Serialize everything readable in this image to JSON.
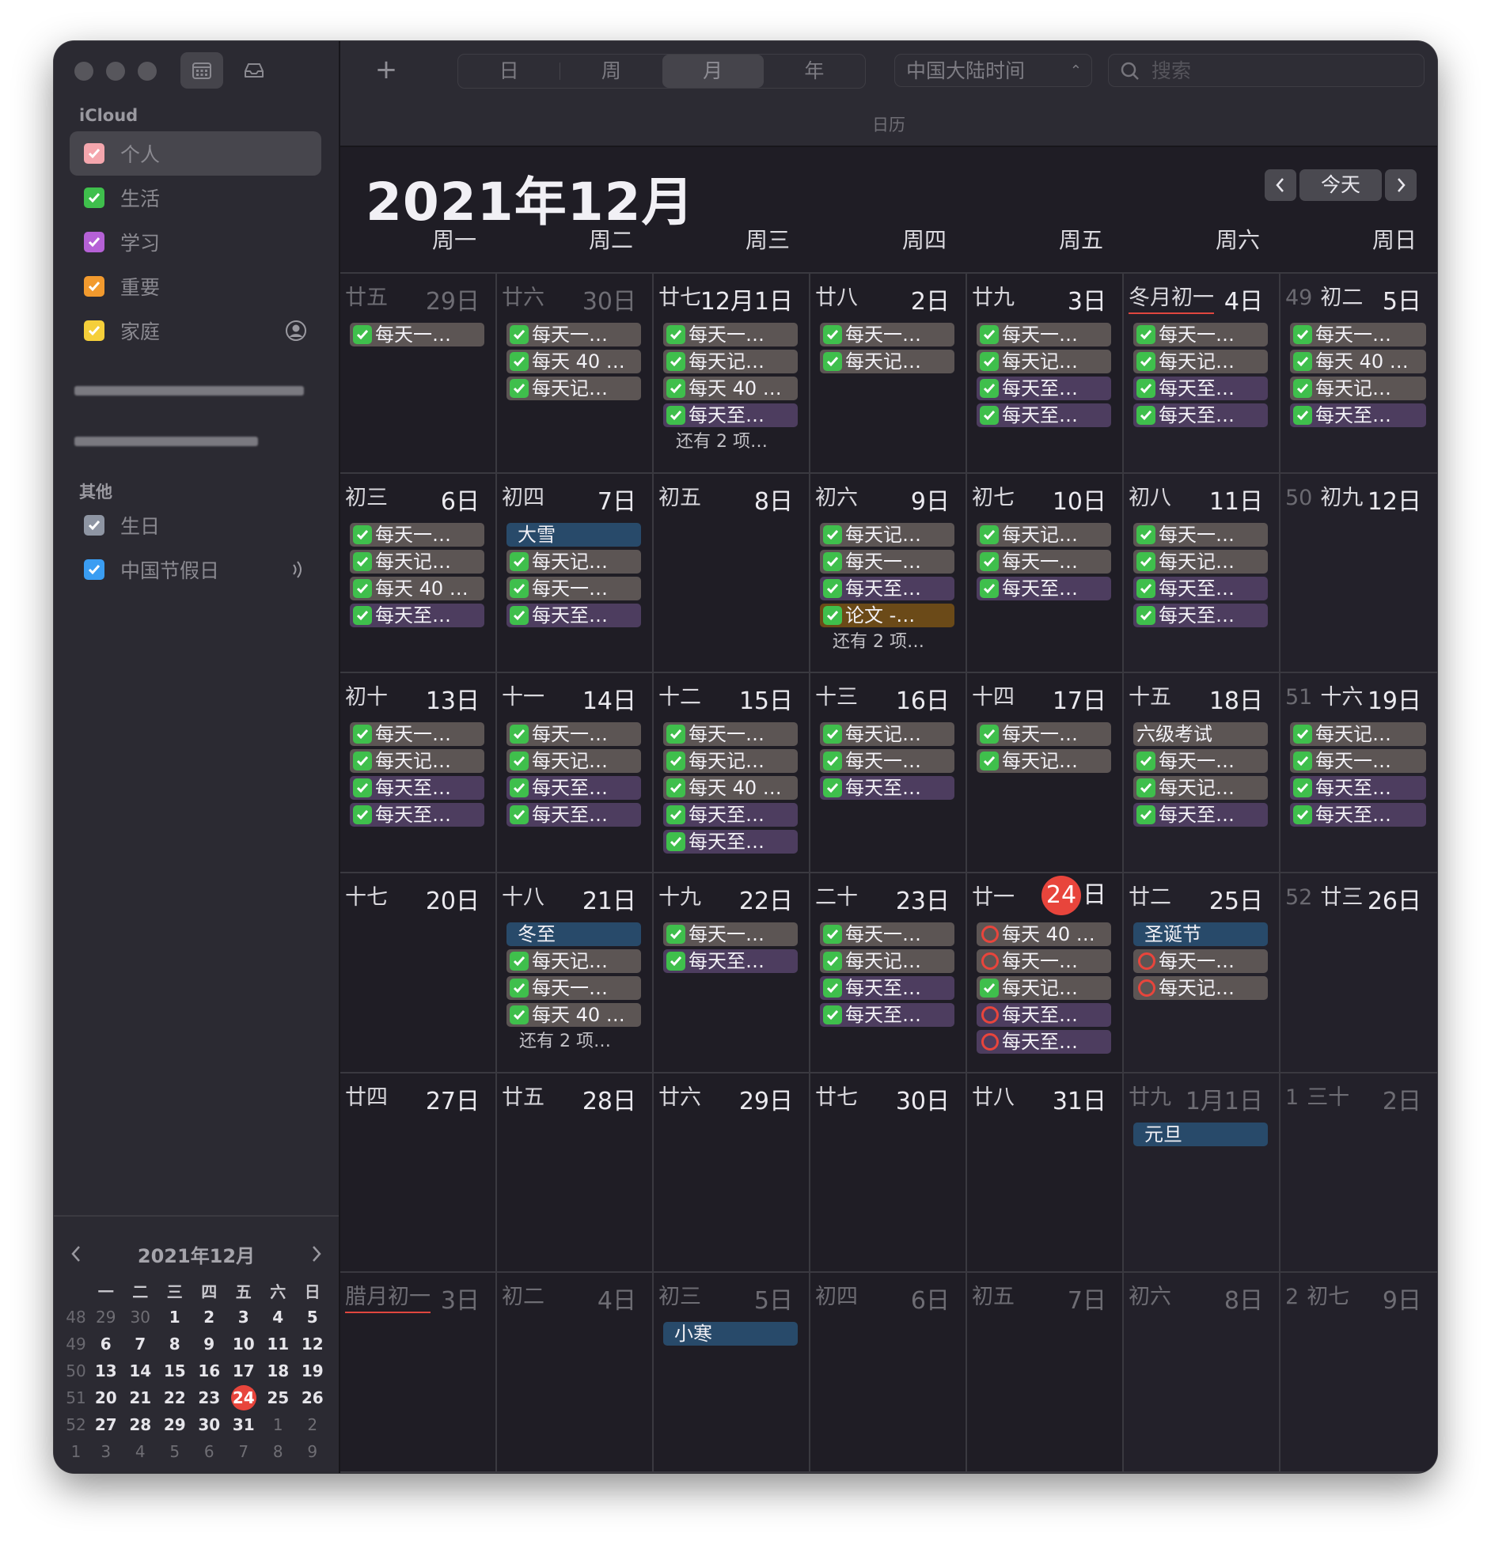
{
  "sidebar": {
    "icloud_title": "iCloud",
    "calendars": [
      {
        "label": "个人",
        "color": "#f4a6ad",
        "selected": true
      },
      {
        "label": "生活",
        "color": "#3fbf4c"
      },
      {
        "label": "学习",
        "color": "#b561d6"
      },
      {
        "label": "重要",
        "color": "#f29a2e"
      },
      {
        "label": "家庭",
        "color": "#f5cf3a"
      }
    ],
    "other_title": "其他",
    "others": [
      {
        "label": "生日",
        "color": "#8e95a3"
      },
      {
        "label": "中国节假日",
        "color": "#3a9df2"
      }
    ],
    "mini": {
      "title": "2021年12月",
      "headers": [
        "一",
        "二",
        "三",
        "四",
        "五",
        "六",
        "日"
      ],
      "rows": [
        {
          "wk": "48",
          "days": [
            "29",
            "30",
            "1",
            "2",
            "3",
            "4",
            "5"
          ]
        },
        {
          "wk": "49",
          "days": [
            "6",
            "7",
            "8",
            "9",
            "10",
            "11",
            "12"
          ]
        },
        {
          "wk": "50",
          "days": [
            "13",
            "14",
            "15",
            "16",
            "17",
            "18",
            "19"
          ]
        },
        {
          "wk": "51",
          "days": [
            "20",
            "21",
            "22",
            "23",
            "24",
            "25",
            "26"
          ]
        },
        {
          "wk": "52",
          "days": [
            "27",
            "28",
            "29",
            "30",
            "31",
            "1",
            "2"
          ]
        },
        {
          "wk": "1",
          "days": [
            "3",
            "4",
            "5",
            "6",
            "7",
            "8",
            "9"
          ]
        }
      ]
    }
  },
  "toolbar": {
    "add": "+",
    "views": [
      "日",
      "周",
      "月",
      "年"
    ],
    "active_view": "月",
    "timezone": "中国大陆时间",
    "search_placeholder": "搜索",
    "subtitle": "日历"
  },
  "header": {
    "title": "2021年12月",
    "today": "今天",
    "weekdays": [
      "周一",
      "周二",
      "周三",
      "周四",
      "周五",
      "周六",
      "周日"
    ]
  },
  "weeks": [
    [
      {
        "lunar": "廿五",
        "day": "29日",
        "dim": true,
        "events": [
          {
            "t": "每天一…",
            "c": "gray",
            "i": "check"
          }
        ]
      },
      {
        "lunar": "廿六",
        "day": "30日",
        "dim": true,
        "events": [
          {
            "t": "每天一…",
            "c": "gray",
            "i": "check"
          },
          {
            "t": "每天 40 …",
            "c": "gray",
            "i": "check"
          },
          {
            "t": "每天记…",
            "c": "gray",
            "i": "check"
          }
        ]
      },
      {
        "lunar": "廿七",
        "day": "12月1日",
        "events": [
          {
            "t": "每天一…",
            "c": "gray",
            "i": "check"
          },
          {
            "t": "每天记…",
            "c": "gray",
            "i": "check"
          },
          {
            "t": "每天 40 …",
            "c": "gray",
            "i": "check"
          },
          {
            "t": "每天至…",
            "c": "purple",
            "i": "check"
          }
        ],
        "more": "还有 2 项…"
      },
      {
        "lunar": "廿八",
        "day": "2日",
        "events": [
          {
            "t": "每天一…",
            "c": "gray",
            "i": "check"
          },
          {
            "t": "每天记…",
            "c": "gray",
            "i": "check"
          }
        ]
      },
      {
        "lunar": "廿九",
        "day": "3日",
        "events": [
          {
            "t": "每天一…",
            "c": "gray",
            "i": "check"
          },
          {
            "t": "每天记…",
            "c": "gray",
            "i": "check"
          },
          {
            "t": "每天至…",
            "c": "purple",
            "i": "check"
          },
          {
            "t": "每天至…",
            "c": "purple",
            "i": "check"
          }
        ]
      },
      {
        "lunar": "冬月初一",
        "day": "4日",
        "term": true,
        "events": [
          {
            "t": "每天一…",
            "c": "gray",
            "i": "check"
          },
          {
            "t": "每天记…",
            "c": "gray",
            "i": "check"
          },
          {
            "t": "每天至…",
            "c": "purple",
            "i": "check"
          },
          {
            "t": "每天至…",
            "c": "purple",
            "i": "check"
          }
        ]
      },
      {
        "wk": "49",
        "lunar": "初二",
        "day": "5日",
        "events": [
          {
            "t": "每天一…",
            "c": "gray",
            "i": "check"
          },
          {
            "t": "每天 40 …",
            "c": "gray",
            "i": "check"
          },
          {
            "t": "每天记…",
            "c": "gray",
            "i": "check"
          },
          {
            "t": "每天至…",
            "c": "purple",
            "i": "check"
          }
        ]
      }
    ],
    [
      {
        "lunar": "初三",
        "day": "6日",
        "events": [
          {
            "t": "每天一…",
            "c": "gray",
            "i": "check"
          },
          {
            "t": "每天记…",
            "c": "gray",
            "i": "check"
          },
          {
            "t": "每天 40 …",
            "c": "gray",
            "i": "check"
          },
          {
            "t": "每天至…",
            "c": "purple",
            "i": "check"
          }
        ]
      },
      {
        "lunar": "初四",
        "day": "7日",
        "events": [
          {
            "t": "大雪",
            "c": "blue"
          },
          {
            "t": "每天记…",
            "c": "gray",
            "i": "check"
          },
          {
            "t": "每天一…",
            "c": "gray",
            "i": "check"
          },
          {
            "t": "每天至…",
            "c": "purple",
            "i": "check"
          }
        ]
      },
      {
        "lunar": "初五",
        "day": "8日",
        "events": []
      },
      {
        "lunar": "初六",
        "day": "9日",
        "events": [
          {
            "t": "每天记…",
            "c": "gray",
            "i": "check"
          },
          {
            "t": "每天一…",
            "c": "gray",
            "i": "check"
          },
          {
            "t": "每天至…",
            "c": "purple",
            "i": "check"
          },
          {
            "t": "论文 -…",
            "c": "brown",
            "i": "check"
          }
        ],
        "more": "还有 2 项…"
      },
      {
        "lunar": "初七",
        "day": "10日",
        "events": [
          {
            "t": "每天记…",
            "c": "gray",
            "i": "check"
          },
          {
            "t": "每天一…",
            "c": "gray",
            "i": "check"
          },
          {
            "t": "每天至…",
            "c": "purple",
            "i": "check"
          }
        ]
      },
      {
        "lunar": "初八",
        "day": "11日",
        "events": [
          {
            "t": "每天一…",
            "c": "gray",
            "i": "check"
          },
          {
            "t": "每天记…",
            "c": "gray",
            "i": "check"
          },
          {
            "t": "每天至…",
            "c": "purple",
            "i": "check"
          },
          {
            "t": "每天至…",
            "c": "purple",
            "i": "check"
          }
        ]
      },
      {
        "wk": "50",
        "lunar": "初九",
        "day": "12日",
        "events": []
      }
    ],
    [
      {
        "lunar": "初十",
        "day": "13日",
        "events": [
          {
            "t": "每天一…",
            "c": "gray",
            "i": "check"
          },
          {
            "t": "每天记…",
            "c": "gray",
            "i": "check"
          },
          {
            "t": "每天至…",
            "c": "purple",
            "i": "check"
          },
          {
            "t": "每天至…",
            "c": "purple",
            "i": "check"
          }
        ]
      },
      {
        "lunar": "十一",
        "day": "14日",
        "events": [
          {
            "t": "每天一…",
            "c": "gray",
            "i": "check"
          },
          {
            "t": "每天记…",
            "c": "gray",
            "i": "check"
          },
          {
            "t": "每天至…",
            "c": "purple",
            "i": "check"
          },
          {
            "t": "每天至…",
            "c": "purple",
            "i": "check"
          }
        ]
      },
      {
        "lunar": "十二",
        "day": "15日",
        "events": [
          {
            "t": "每天一…",
            "c": "gray",
            "i": "check"
          },
          {
            "t": "每天记…",
            "c": "gray",
            "i": "check"
          },
          {
            "t": "每天 40 …",
            "c": "gray",
            "i": "check"
          },
          {
            "t": "每天至…",
            "c": "purple",
            "i": "check"
          },
          {
            "t": "每天至…",
            "c": "purple",
            "i": "check"
          }
        ]
      },
      {
        "lunar": "十三",
        "day": "16日",
        "events": [
          {
            "t": "每天记…",
            "c": "gray",
            "i": "check"
          },
          {
            "t": "每天一…",
            "c": "gray",
            "i": "check"
          },
          {
            "t": "每天至…",
            "c": "purple",
            "i": "check"
          }
        ]
      },
      {
        "lunar": "十四",
        "day": "17日",
        "events": [
          {
            "t": "每天一…",
            "c": "gray",
            "i": "check"
          },
          {
            "t": "每天记…",
            "c": "gray",
            "i": "check"
          }
        ]
      },
      {
        "lunar": "十五",
        "day": "18日",
        "events": [
          {
            "t": "六级考试",
            "c": "gray"
          },
          {
            "t": "每天一…",
            "c": "gray",
            "i": "check"
          },
          {
            "t": "每天记…",
            "c": "gray",
            "i": "check"
          },
          {
            "t": "每天至…",
            "c": "purple",
            "i": "check"
          }
        ]
      },
      {
        "wk": "51",
        "lunar": "十六",
        "day": "19日",
        "events": [
          {
            "t": "每天记…",
            "c": "gray",
            "i": "check"
          },
          {
            "t": "每天一…",
            "c": "gray",
            "i": "check"
          },
          {
            "t": "每天至…",
            "c": "purple",
            "i": "check"
          },
          {
            "t": "每天至…",
            "c": "purple",
            "i": "check"
          }
        ]
      }
    ],
    [
      {
        "lunar": "十七",
        "day": "20日",
        "events": []
      },
      {
        "lunar": "十八",
        "day": "21日",
        "events": [
          {
            "t": "冬至",
            "c": "blue"
          },
          {
            "t": "每天记…",
            "c": "gray",
            "i": "check"
          },
          {
            "t": "每天一…",
            "c": "gray",
            "i": "check"
          },
          {
            "t": "每天 40 …",
            "c": "gray",
            "i": "check"
          }
        ],
        "more": "还有 2 项…"
      },
      {
        "lunar": "十九",
        "day": "22日",
        "events": [
          {
            "t": "每天一…",
            "c": "gray",
            "i": "check"
          },
          {
            "t": "每天至…",
            "c": "purple",
            "i": "check"
          }
        ]
      },
      {
        "lunar": "二十",
        "day": "23日",
        "events": [
          {
            "t": "每天一…",
            "c": "gray",
            "i": "check"
          },
          {
            "t": "每天记…",
            "c": "gray",
            "i": "check"
          },
          {
            "t": "每天至…",
            "c": "purple",
            "i": "check"
          },
          {
            "t": "每天至…",
            "c": "purple",
            "i": "check"
          }
        ]
      },
      {
        "lunar": "廿一",
        "day": "24",
        "day_suffix": "日",
        "today": true,
        "events": [
          {
            "t": "每天 40 …",
            "c": "gray",
            "i": "ring"
          },
          {
            "t": "每天一…",
            "c": "gray",
            "i": "ring"
          },
          {
            "t": "每天记…",
            "c": "gray",
            "i": "check"
          },
          {
            "t": "每天至…",
            "c": "purple",
            "i": "ring"
          },
          {
            "t": "每天至…",
            "c": "purple",
            "i": "ring"
          }
        ]
      },
      {
        "lunar": "廿二",
        "day": "25日",
        "events": [
          {
            "t": "圣诞节",
            "c": "blue"
          },
          {
            "t": "每天一…",
            "c": "gray",
            "i": "ring"
          },
          {
            "t": "每天记…",
            "c": "gray",
            "i": "ring"
          }
        ]
      },
      {
        "wk": "52",
        "lunar": "廿三",
        "day": "26日",
        "events": []
      }
    ],
    [
      {
        "lunar": "廿四",
        "day": "27日",
        "events": []
      },
      {
        "lunar": "廿五",
        "day": "28日",
        "events": []
      },
      {
        "lunar": "廿六",
        "day": "29日",
        "events": []
      },
      {
        "lunar": "廿七",
        "day": "30日",
        "events": []
      },
      {
        "lunar": "廿八",
        "day": "31日",
        "events": []
      },
      {
        "lunar": "廿九",
        "day": "1月1日",
        "dim": true,
        "events": [
          {
            "t": "元旦",
            "c": "blue"
          }
        ]
      },
      {
        "wk": "1",
        "lunar": "三十",
        "day": "2日",
        "dim": true,
        "events": []
      }
    ],
    [
      {
        "lunar": "腊月初一",
        "day": "3日",
        "dim": true,
        "term": true,
        "events": []
      },
      {
        "lunar": "初二",
        "day": "4日",
        "dim": true,
        "events": []
      },
      {
        "lunar": "初三",
        "day": "5日",
        "dim": true,
        "events": [
          {
            "t": "小寒",
            "c": "blue"
          }
        ]
      },
      {
        "lunar": "初四",
        "day": "6日",
        "dim": true,
        "events": []
      },
      {
        "lunar": "初五",
        "day": "7日",
        "dim": true,
        "events": []
      },
      {
        "lunar": "初六",
        "day": "8日",
        "dim": true,
        "events": []
      },
      {
        "wk": "2",
        "lunar": "初七",
        "day": "9日",
        "dim": true,
        "events": []
      }
    ]
  ]
}
